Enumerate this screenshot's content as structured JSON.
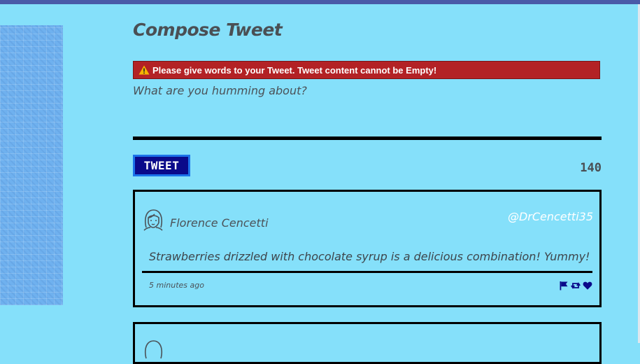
{
  "compose": {
    "title": "Compose Tweet",
    "error": "Please give words to your Tweet. Tweet content cannot be Empty!",
    "placeholder": "What are you humming about?",
    "button_label": "TWEET",
    "counter": "140"
  },
  "colors": {
    "background": "#85e0fa",
    "error": "#b32225",
    "button": "#0a0a8a",
    "button_border": "#1b72ea",
    "action_icons": "#0a0a8a"
  },
  "tweets": [
    {
      "name": "Florence Cencetti",
      "handle": "@DrCencetti35",
      "text": "Strawberries drizzled with chocolate syrup is a delicious combination! Yummy!",
      "time": "5 minutes ago",
      "avatar_icon": "avatar-icon",
      "actions": [
        "flag-icon",
        "retweet-icon",
        "heart-icon"
      ]
    }
  ]
}
